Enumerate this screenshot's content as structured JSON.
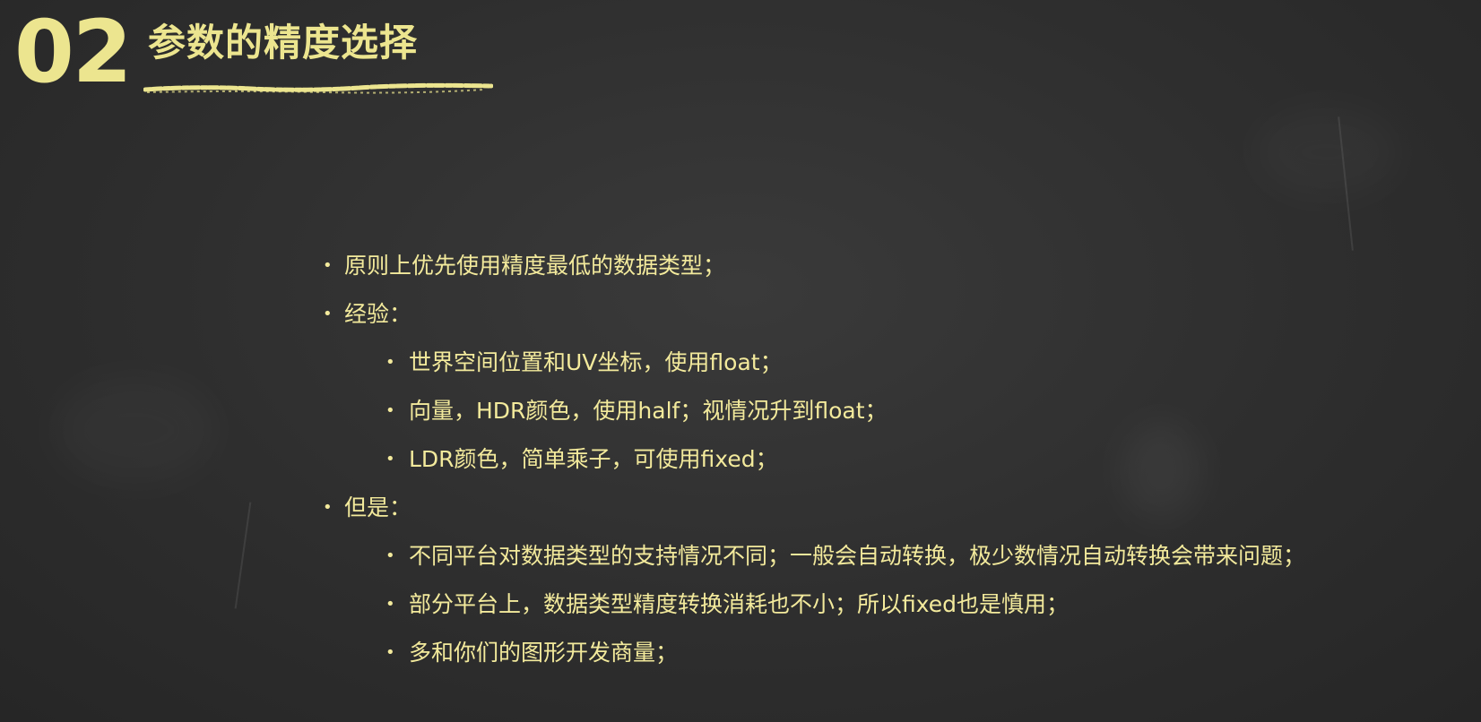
{
  "header": {
    "number": "02",
    "title": "参数的精度选择"
  },
  "colors": {
    "background": "#2e2e2e",
    "chalk_yellow": "#ece58f",
    "text": "#f3ea9c"
  },
  "bullets": [
    {
      "level": 1,
      "text": "原则上优先使用精度最低的数据类型；"
    },
    {
      "level": 1,
      "text": "经验："
    },
    {
      "level": 2,
      "text": "世界空间位置和UV坐标，使用float；"
    },
    {
      "level": 2,
      "text": "向量，HDR颜色，使用half；视情况升到float；"
    },
    {
      "level": 2,
      "text": "LDR颜色，简单乘子，可使用fixed；"
    },
    {
      "level": 1,
      "text": "但是："
    },
    {
      "level": 2,
      "text": "不同平台对数据类型的支持情况不同；一般会自动转换，极少数情况自动转换会带来问题；"
    },
    {
      "level": 2,
      "text": "部分平台上，数据类型精度转换消耗也不小；所以fixed也是慎用；"
    },
    {
      "level": 2,
      "text": "多和你们的图形开发商量；"
    }
  ]
}
